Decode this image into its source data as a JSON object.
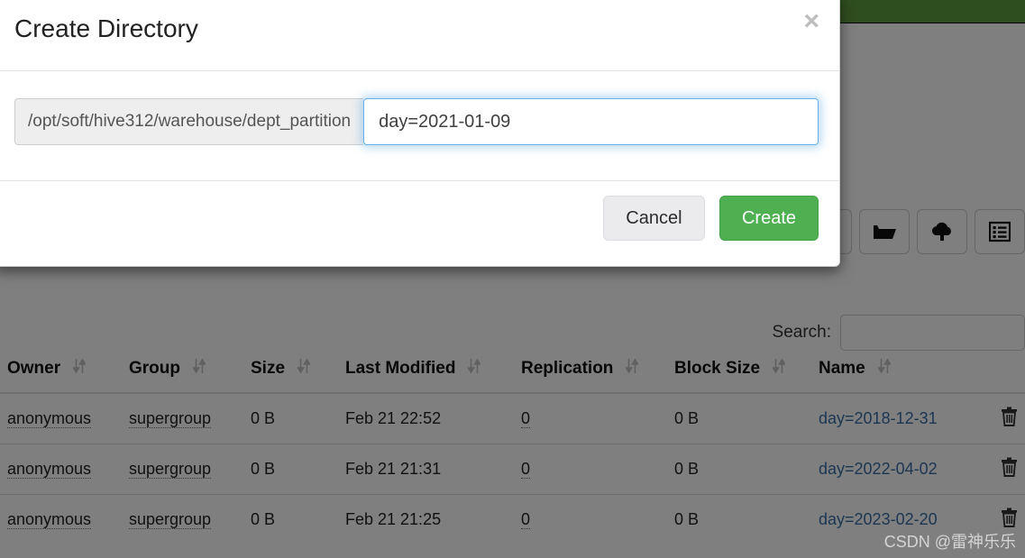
{
  "navbar": {
    "color": "#5e9c3f"
  },
  "modal": {
    "title": "Create Directory",
    "close_label": "×",
    "path_prefix": "/opt/soft/hive312/warehouse/dept_partition",
    "dirname_value": "day=2021-01-09",
    "dirname_placeholder": "",
    "cancel_label": "Cancel",
    "create_label": "Create",
    "create_color": "#4fb052"
  },
  "toolbar": {
    "buttons": [
      {
        "name": "new-directory-button",
        "icon": "folder-open-icon"
      },
      {
        "name": "upload-button",
        "icon": "cloud-upload-icon"
      },
      {
        "name": "cut-vpaste-button",
        "icon": "list-alt-icon"
      }
    ]
  },
  "search": {
    "label": "Search:",
    "value": "",
    "placeholder": ""
  },
  "table": {
    "columns": [
      "Owner",
      "Group",
      "Size",
      "Last Modified",
      "Replication",
      "Block Size",
      "Name",
      ""
    ],
    "rows": [
      {
        "owner": "anonymous",
        "group": "supergroup",
        "size": "0 B",
        "last_modified": "Feb 21 22:52",
        "replication": "0",
        "block_size": "0 B",
        "name": "day=2018-12-31",
        "delete_icon": "trash-icon"
      },
      {
        "owner": "anonymous",
        "group": "supergroup",
        "size": "0 B",
        "last_modified": "Feb 21 21:31",
        "replication": "0",
        "block_size": "0 B",
        "name": "day=2022-04-02",
        "delete_icon": "trash-icon"
      },
      {
        "owner": "anonymous",
        "group": "supergroup",
        "size": "0 B",
        "last_modified": "Feb 21 21:25",
        "replication": "0",
        "block_size": "0 B",
        "name": "day=2023-02-20",
        "delete_icon": "trash-icon"
      }
    ]
  },
  "watermark": {
    "text": "CSDN @雷神乐乐"
  }
}
